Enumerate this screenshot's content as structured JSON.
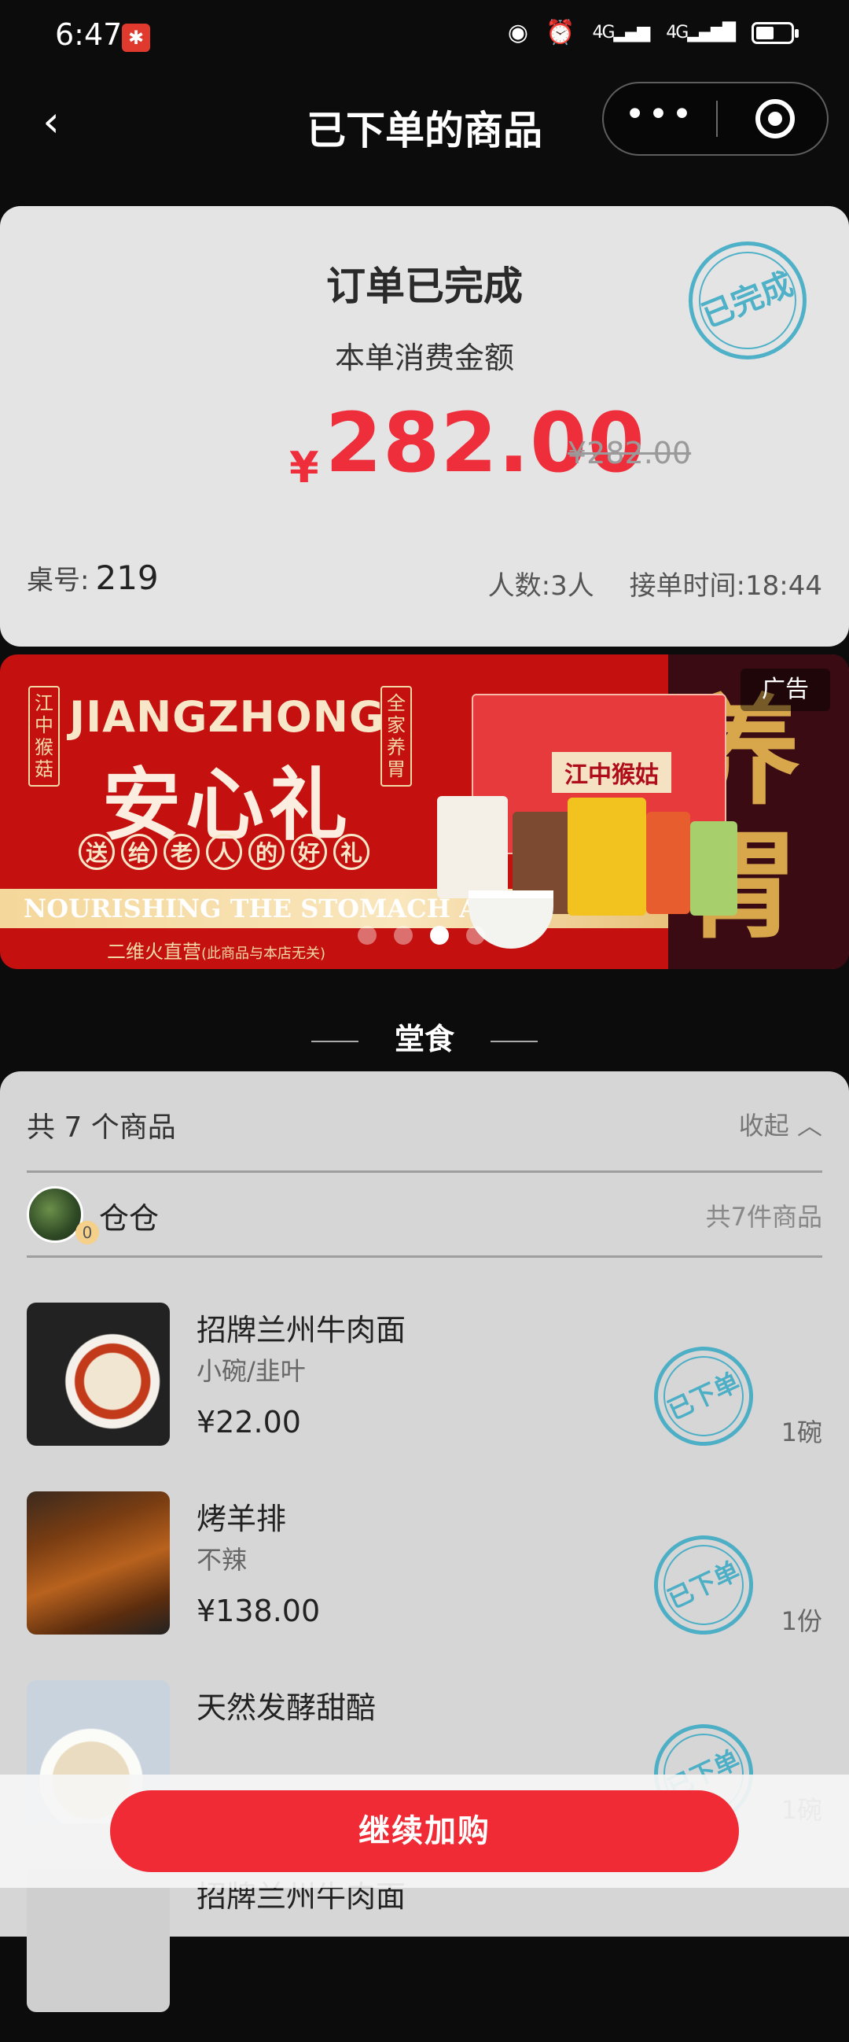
{
  "status_bar": {
    "time": "6:47",
    "network1": "4G",
    "network2": "4G"
  },
  "nav": {
    "title": "已下单的商品",
    "back_symbol": "‹",
    "more_symbol": "•••"
  },
  "summary": {
    "status": "订单已完成",
    "stamp": "已完成",
    "amount_label": "本单消费金额",
    "currency": "¥",
    "amount": "282.00",
    "original_amount": "¥282.00",
    "table_label": "桌号:",
    "table_number": "219",
    "people": "人数:3人",
    "order_time": "接单时间:18:44"
  },
  "banner": {
    "ad_label": "广告",
    "brand_en": "JIANGZHONG",
    "brand_cn": "安心礼",
    "tagline_chars": [
      "送",
      "给",
      "老",
      "人",
      "的",
      "好",
      "礼"
    ],
    "left_tag": "江中猴菇",
    "right_tag": "全家养胃",
    "strip_text": "NOURISHING THE STOMACH AND C",
    "footer": "二维火直营",
    "footer_note": "(此商品与本店无关)",
    "side_text": "养胃",
    "box_label": "江中猴姑",
    "dots": 4,
    "active_dot": 3
  },
  "section": {
    "label": "堂食"
  },
  "items_panel": {
    "count_text": "共 7 个商品",
    "collapse_label": "收起",
    "store": {
      "name": "仓仓",
      "badge": "0",
      "count": "共7件商品"
    },
    "items": [
      {
        "name": "招牌兰州牛肉面",
        "spec": "小碗/韭叶",
        "price": "¥22.00",
        "qty": "1碗",
        "stamp": "已下单"
      },
      {
        "name": "烤羊排",
        "spec": "不辣",
        "price": "¥138.00",
        "qty": "1份",
        "stamp": "已下单"
      },
      {
        "name": "天然发酵甜醅",
        "spec": "",
        "price": "",
        "qty": "1碗",
        "stamp": "已下单"
      },
      {
        "name": "招牌兰州牛肉面",
        "spec": "",
        "price": "",
        "qty": "",
        "stamp": ""
      }
    ]
  },
  "bottom": {
    "cta_label": "继续加购"
  }
}
